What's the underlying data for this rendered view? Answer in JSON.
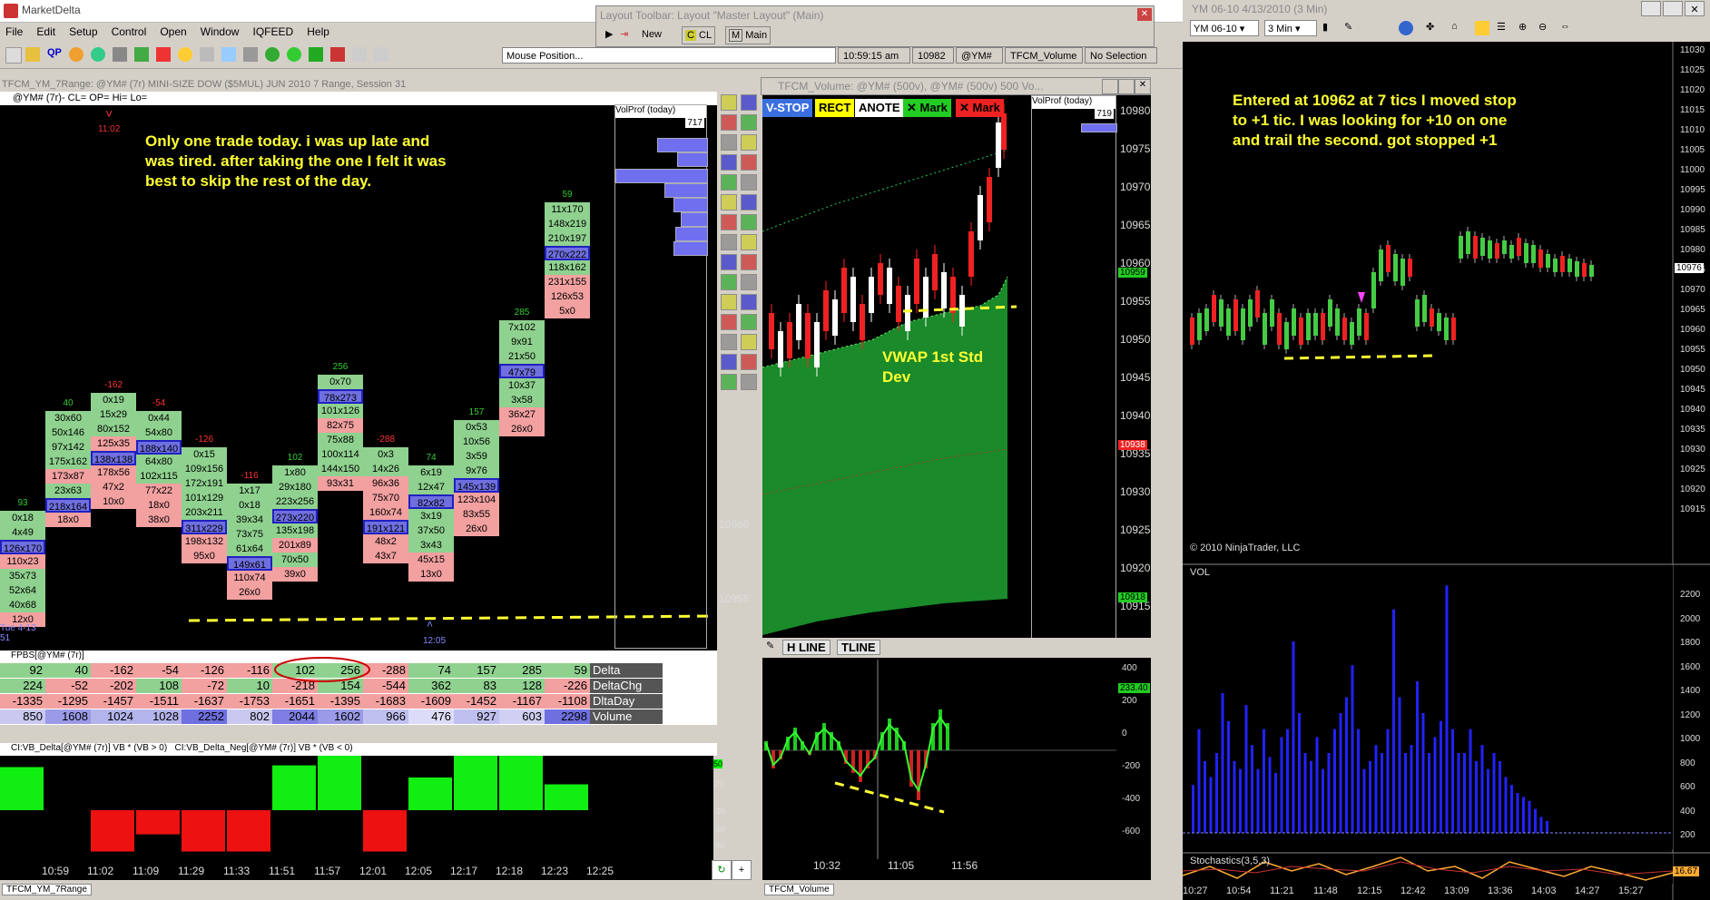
{
  "md": {
    "app_title": "MarketDelta",
    "menu": [
      "File",
      "Edit",
      "Setup",
      "Control",
      "Open",
      "Window",
      "IQFEED",
      "Help"
    ],
    "mouse_position": "Mouse Position...",
    "status": [
      "10:59:15 am",
      "10982",
      "@YM#",
      "TFCM_Volume",
      "No Selection"
    ],
    "layout_toolbar": {
      "title": "Layout Toolbar: Layout \"Master Layout\" (Main)",
      "new": "New",
      "cl": "CL",
      "main": "Main"
    },
    "chart1_title": "TFCM_YM_7Range: @YM# (7r) MINI-SIZE DOW ($5MUL) JUN 2010 7 Range, Session 31",
    "chart1_header": "@YM# (7r)- CL= OP= Hi= Lo=",
    "annotation": "Only one trade today.  i was up late and was tired.  after taking the one I felt it was best to skip the rest of the day.",
    "volprof_label": "VolProf (today)",
    "volprof_value": "717",
    "price_labels_chart1": [
      "10960",
      "10955"
    ],
    "fp_label": "FPBS[@YM# (7r)]",
    "delta_rows": [
      {
        "label": "Delta",
        "values": [
          "92",
          "40",
          "-162",
          "-54",
          "-126",
          "-116",
          "102",
          "256",
          "-288",
          "74",
          "157",
          "285",
          "59"
        ]
      },
      {
        "label": "DeltaChg",
        "values": [
          "224",
          "-52",
          "-202",
          "108",
          "-72",
          "10",
          "-218",
          "154",
          "-544",
          "362",
          "83",
          "128",
          "-226"
        ]
      },
      {
        "label": "DltaDay",
        "values": [
          "-1335",
          "-1295",
          "-1457",
          "-1511",
          "-1637",
          "-1753",
          "-1651",
          "-1395",
          "-1683",
          "-1609",
          "-1452",
          "-1167",
          "-1108"
        ]
      },
      {
        "label": "Volume",
        "values": [
          "850",
          "1608",
          "1024",
          "1028",
          "2252",
          "802",
          "2044",
          "1602",
          "966",
          "476",
          "927",
          "603",
          "2298"
        ]
      }
    ],
    "bar_label_pos": "CI:VB_Delta[@YM# (7r)] VB * (VB > 0)",
    "bar_label_neg": "CI:VB_Delta_Neg[@YM# (7r)] VB * (VB < 0)",
    "bar_axis": [
      "50",
      "20",
      "-20",
      "-50",
      "-80"
    ],
    "time_labels": [
      "10:59",
      "11:02",
      "11:09",
      "11:29",
      "11:33",
      "11:51",
      "11:57",
      "12:01",
      "12:05",
      "12:17",
      "12:18",
      "12:23",
      "12:25"
    ],
    "chart1_markers": {
      "top": "11:02",
      "mid": "12:05",
      "left": "Tue 4-13 51"
    },
    "footer_tab": "TFCM_YM_7Range",
    "footer_tab2": "TFCM_Volume"
  },
  "chart_data": [
    {
      "type": "table",
      "title": "",
      "columns_headers_delta": [
        "93",
        "40",
        "-162",
        "-54",
        "-126",
        "-116",
        "102",
        "256",
        "-288",
        "74",
        "157",
        "285",
        "59"
      ],
      "columns": [
        {
          "cells": [
            [
              "0x18",
              "g"
            ],
            [
              "4x49",
              "g"
            ],
            [
              "126x170",
              "b"
            ],
            [
              "110x23",
              "r"
            ],
            [
              "35x73",
              "g"
            ],
            [
              "52x64",
              "g"
            ],
            [
              "40x68",
              "g"
            ],
            [
              "12x0",
              "r"
            ]
          ]
        },
        {
          "cells": [
            [
              "30x60",
              "g"
            ],
            [
              "50x146",
              "g"
            ],
            [
              "97x142",
              "g"
            ],
            [
              "175x162",
              "g"
            ],
            [
              "173x87",
              "r"
            ],
            [
              "23x63",
              "g"
            ],
            [
              "218x164",
              "b"
            ],
            [
              "18x0",
              "r"
            ]
          ]
        },
        {
          "cells": [
            [
              "0x19",
              "g"
            ],
            [
              "15x29",
              "g"
            ],
            [
              "80x152",
              "g"
            ],
            [
              "125x35",
              "r"
            ],
            [
              "138x138",
              "b"
            ],
            [
              "178x56",
              "r"
            ],
            [
              "47x2",
              "r"
            ],
            [
              "10x0",
              "r"
            ]
          ]
        },
        {
          "cells": [
            [
              "0x44",
              "g"
            ],
            [
              "54x80",
              "g"
            ],
            [
              "188x140",
              "b"
            ],
            [
              "64x80",
              "g"
            ],
            [
              "102x115",
              "g"
            ],
            [
              "77x22",
              "r"
            ],
            [
              "18x0",
              "r"
            ],
            [
              "38x0",
              "r"
            ]
          ]
        },
        {
          "cells": [
            [
              "0x15",
              "g"
            ],
            [
              "109x156",
              "g"
            ],
            [
              "172x191",
              "g"
            ],
            [
              "101x129",
              "g"
            ],
            [
              "203x211",
              "g"
            ],
            [
              "311x229",
              "b"
            ],
            [
              "198x132",
              "r"
            ],
            [
              "95x0",
              "r"
            ]
          ]
        },
        {
          "cells": [
            [
              "1x17",
              "g"
            ],
            [
              "0x18",
              "g"
            ],
            [
              "39x34",
              "g"
            ],
            [
              "73x75",
              "g"
            ],
            [
              "61x64",
              "g"
            ],
            [
              "149x61",
              "b"
            ],
            [
              "110x74",
              "r"
            ],
            [
              "26x0",
              "r"
            ]
          ]
        },
        {
          "cells": [
            [
              "1x80",
              "g"
            ],
            [
              "29x180",
              "g"
            ],
            [
              "223x256",
              "g"
            ],
            [
              "273x220",
              "b"
            ],
            [
              "135x198",
              "g"
            ],
            [
              "201x89",
              "r"
            ],
            [
              "70x50",
              "g"
            ],
            [
              "39x0",
              "r"
            ]
          ]
        },
        {
          "cells": [
            [
              "0x70",
              "g"
            ],
            [
              "78x273",
              "b"
            ],
            [
              "101x126",
              "g"
            ],
            [
              "82x75",
              "r"
            ],
            [
              "75x88",
              "g"
            ],
            [
              "100x114",
              "g"
            ],
            [
              "144x150",
              "g"
            ],
            [
              "93x31",
              "r"
            ]
          ]
        },
        {
          "cells": [
            [
              "0x3",
              "g"
            ],
            [
              "14x26",
              "g"
            ],
            [
              "96x36",
              "r"
            ],
            [
              "75x70",
              "r"
            ],
            [
              "160x74",
              "r"
            ],
            [
              "191x121",
              "b"
            ],
            [
              "48x2",
              "r"
            ],
            [
              "43x7",
              "r"
            ]
          ]
        },
        {
          "cells": [
            [
              "6x19",
              "g"
            ],
            [
              "12x47",
              "g"
            ],
            [
              "82x82",
              "b"
            ],
            [
              "3x19",
              "g"
            ],
            [
              "37x50",
              "g"
            ],
            [
              "3x43",
              "g"
            ],
            [
              "45x15",
              "r"
            ],
            [
              "13x0",
              "r"
            ]
          ]
        },
        {
          "cells": [
            [
              "0x53",
              "g"
            ],
            [
              "10x56",
              "g"
            ],
            [
              "3x59",
              "g"
            ],
            [
              "9x76",
              "g"
            ],
            [
              "145x139",
              "b"
            ],
            [
              "123x104",
              "r"
            ],
            [
              "83x55",
              "r"
            ],
            [
              "26x0",
              "r"
            ]
          ]
        },
        {
          "cells": [
            [
              "7x102",
              "g"
            ],
            [
              "9x91",
              "g"
            ],
            [
              "21x50",
              "g"
            ],
            [
              "47x79",
              "b"
            ],
            [
              "10x37",
              "g"
            ],
            [
              "3x58",
              "g"
            ],
            [
              "36x27",
              "r"
            ],
            [
              "26x0",
              "r"
            ]
          ]
        },
        {
          "cells": [
            [
              "11x170",
              "g"
            ],
            [
              "148x219",
              "g"
            ],
            [
              "210x197",
              "g"
            ],
            [
              "270x222",
              "b"
            ],
            [
              "118x162",
              "g"
            ],
            [
              "231x155",
              "r"
            ],
            [
              "126x53",
              "r"
            ],
            [
              "5x0",
              "r"
            ]
          ]
        }
      ]
    }
  ],
  "mid": {
    "title": "TFCM_Volume: @YM# (500v), @YM# (500v) 500 Vo...",
    "buttons": [
      "V-STOP",
      "RECT",
      "ANOTE",
      "Mark",
      "Mark"
    ],
    "volprof_label": "VolProf (today)",
    "volprof_value": "719",
    "prices": [
      "10980",
      "10975",
      "10970",
      "10965",
      "10960",
      "10955",
      "10950",
      "10945",
      "10940",
      "10935",
      "10930",
      "10925",
      "10920",
      "10915"
    ],
    "tag_green": "10959",
    "tag_red": "10938",
    "tag_green2": "10918",
    "annotation": "VWAP 1st Std Dev",
    "tools": [
      "H LINE",
      "TLINE"
    ],
    "lower_axis": [
      "400",
      "200",
      "0",
      "-200",
      "-400",
      "-600"
    ],
    "lower_tag": "233.40",
    "times": [
      "10:32",
      "11:05",
      "11:56"
    ]
  },
  "ninja": {
    "title": "YM 06-10   4/13/2010 (3 Min)",
    "instrument": "YM 06-10",
    "interval": "3 Min",
    "annotation": "Entered at 10962 at 7 tics I moved stop to +1 tic.  I was looking for +10 on one and trail the second.  got stopped +1",
    "copyright": "© 2010 NinjaTrader, LLC",
    "prices": [
      "11030",
      "11025",
      "11020",
      "11015",
      "11010",
      "11005",
      "11000",
      "10995",
      "10990",
      "10985",
      "10980",
      "10975",
      "10970",
      "10965",
      "10960",
      "10955",
      "10950",
      "10945",
      "10940",
      "10935",
      "10930",
      "10925",
      "10920",
      "10915"
    ],
    "last_price": "10976",
    "vol_label": "VOL",
    "vol_axis": [
      "2200",
      "2000",
      "1800",
      "1600",
      "1400",
      "1200",
      "1000",
      "800",
      "600",
      "400",
      "200"
    ],
    "stoch_label": "Stochastics(3,5,3)",
    "stoch_value": "16.67",
    "times": [
      "10:27",
      "10:54",
      "11:21",
      "11:48",
      "12:15",
      "12:42",
      "13:09",
      "13:36",
      "14:03",
      "14:27",
      "15:27"
    ]
  }
}
